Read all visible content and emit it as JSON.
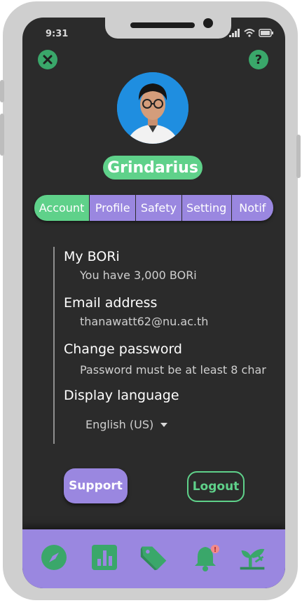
{
  "status_bar": {
    "time": "9:31",
    "icons": [
      "signal-icon",
      "wifi-icon",
      "battery-icon"
    ]
  },
  "header": {
    "close_icon": "close-icon",
    "help_icon": "help-icon"
  },
  "profile": {
    "username": "Grindarius"
  },
  "tabs": [
    {
      "label": "Account",
      "active": true
    },
    {
      "label": "Profile",
      "active": false
    },
    {
      "label": "Safety",
      "active": false
    },
    {
      "label": "Setting",
      "active": false
    },
    {
      "label": "Notif",
      "active": false
    }
  ],
  "account": {
    "bori_label": "My BORi",
    "bori_value": "You have 3,000 BORi",
    "email_label": "Email address",
    "email_value": "thanawatt62@nu.ac.th",
    "password_label": "Change password",
    "password_value": "Password must be at least 8 char",
    "language_label": "Display language",
    "language_value": "English (US)"
  },
  "buttons": {
    "support": "Support",
    "logout": "Logout"
  },
  "bottom_nav": {
    "items": [
      "compass-icon",
      "chart-icon",
      "tag-icon",
      "bell-icon",
      "sprout-icon"
    ],
    "notification_badge": "!"
  },
  "colors": {
    "green": "#5fd18a",
    "purple": "#9a87e0",
    "dark": "#2b2b2b",
    "icon_green": "#3aa76a"
  }
}
